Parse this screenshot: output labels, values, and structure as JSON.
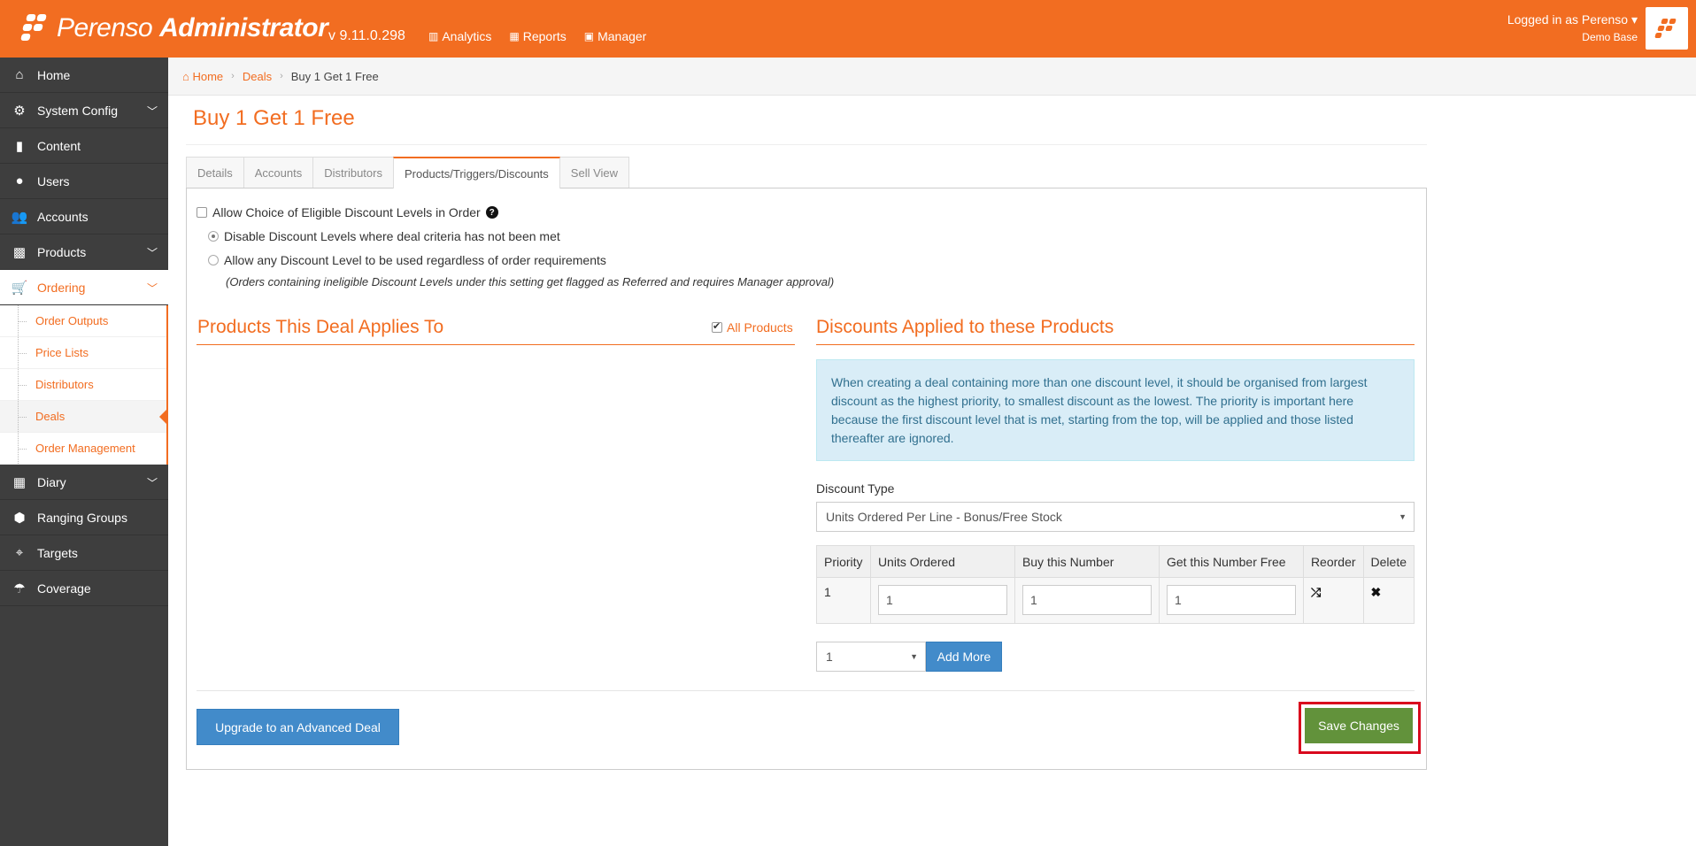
{
  "header": {
    "brand_light": "Perenso",
    "brand_bold": "Administrator",
    "version": "v 9.11.0.298",
    "nav": [
      {
        "icon": "chart-icon",
        "label": "Analytics"
      },
      {
        "icon": "table-icon",
        "label": "Reports"
      },
      {
        "icon": "briefcase-icon",
        "label": "Manager"
      }
    ],
    "user_line1": "Logged in as Perenso",
    "user_line2": "Demo Base"
  },
  "sidebar": {
    "items": [
      {
        "label": "Home",
        "icon": "home-icon"
      },
      {
        "label": "System Config",
        "icon": "gear-icon"
      },
      {
        "label": "Content",
        "icon": "file-icon"
      },
      {
        "label": "Users",
        "icon": "user-icon"
      },
      {
        "label": "Accounts",
        "icon": "users-icon"
      },
      {
        "label": "Products",
        "icon": "gift-icon"
      },
      {
        "label": "Ordering",
        "icon": "cart-icon"
      },
      {
        "label": "Diary",
        "icon": "calendar-icon"
      },
      {
        "label": "Ranging Groups",
        "icon": "cubes-icon"
      },
      {
        "label": "Targets",
        "icon": "crosshairs-icon"
      },
      {
        "label": "Coverage",
        "icon": "umbrella-icon"
      }
    ],
    "ordering_sub": [
      "Order Outputs",
      "Price Lists",
      "Distributors",
      "Deals",
      "Order Management"
    ]
  },
  "breadcrumb": {
    "home": "Home",
    "deals": "Deals",
    "current": "Buy 1 Get 1 Free"
  },
  "page_title": "Buy 1 Get 1 Free",
  "tabs": [
    "Details",
    "Accounts",
    "Distributors",
    "Products/Triggers/Discounts",
    "Sell View"
  ],
  "options": {
    "allow_choice": "Allow Choice of Eligible Discount Levels in Order",
    "disable_levels": "Disable Discount Levels where deal criteria has not been met",
    "allow_any": "Allow any Discount Level to be used regardless of order requirements",
    "note": "(Orders containing ineligible Discount Levels under this setting get flagged as Referred and requires Manager approval)"
  },
  "products_section": {
    "title": "Products This Deal Applies To",
    "all_products": "All Products"
  },
  "discounts_section": {
    "title": "Discounts Applied to these Products",
    "info": "When creating a deal containing more than one discount level, it should be organised from largest discount as the highest priority, to smallest discount as the lowest. The priority is important here because the first discount level that is met, starting from the top, will be applied and those listed thereafter are ignored.",
    "discount_type_label": "Discount Type",
    "discount_type_value": "Units Ordered Per Line - Bonus/Free Stock",
    "table_headers": [
      "Priority",
      "Units Ordered",
      "Buy this Number",
      "Get this Number Free",
      "Reorder",
      "Delete"
    ],
    "rows": [
      {
        "priority": "1",
        "units_ordered": "1",
        "buy": "1",
        "free": "1"
      }
    ],
    "add_count": "1",
    "add_more": "Add More"
  },
  "buttons": {
    "upgrade": "Upgrade to an Advanced Deal",
    "save": "Save Changes"
  },
  "colors": {
    "brand": "#f26d21",
    "sidebar": "#3e3e3e",
    "primary": "#428bca",
    "success": "#62923b",
    "highlight": "#d9091d"
  }
}
